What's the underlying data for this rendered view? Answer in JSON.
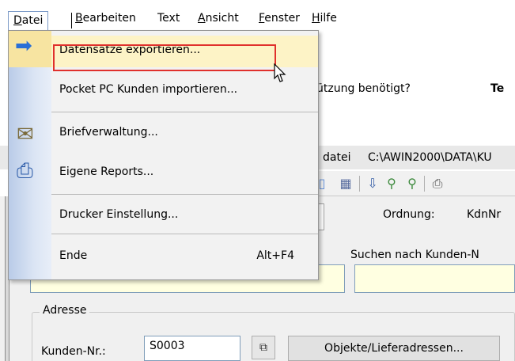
{
  "menubar": {
    "items": [
      {
        "label": "Datei",
        "underline": "D"
      },
      {
        "label": "Bearbeiten",
        "underline": "B"
      },
      {
        "label": "Text",
        "underline": ""
      },
      {
        "label": "Ansicht",
        "underline": "A"
      },
      {
        "label": "Fenster",
        "underline": "F"
      },
      {
        "label": "Hilfe",
        "underline": "H"
      }
    ]
  },
  "background": {
    "question_text": "ützung benötigt?",
    "question_bold": "Te",
    "file_label": "datei",
    "file_path": "C:\\AWIN2000\\DATA\\KU",
    "order_label": "Ordnung:",
    "order_value": "KdnNr",
    "search_label": "Suchen nach Kunden-N",
    "group_label": "Adresse",
    "customer_no_label": "Kunden-Nr.:",
    "customer_no_value": "S0003",
    "objects_button": "Objekte/Lieferadressen..."
  },
  "dropdown": {
    "items": [
      {
        "label": "Datensätze exportieren...",
        "accel": "e",
        "shortcut": "",
        "icon": "arrow-right-icon",
        "highlighted": true
      },
      {
        "label": "Pocket PC Kunden importieren...",
        "accel": "",
        "shortcut": "",
        "icon": "",
        "highlighted": false
      },
      {
        "label": "Briefverwaltung...",
        "accel": "",
        "shortcut": "",
        "icon": "envelope-pen-icon",
        "highlighted": false
      },
      {
        "label": "Eigene Reports...",
        "accel": "",
        "shortcut": "",
        "icon": "printer-icon",
        "highlighted": false
      },
      {
        "label": "Drucker Einstellung...",
        "accel": "D",
        "shortcut": "",
        "icon": "",
        "highlighted": false
      },
      {
        "label": "Ende",
        "accel": "E",
        "shortcut": "Alt+F4",
        "icon": "",
        "highlighted": false
      }
    ]
  },
  "colors": {
    "highlight_bg": "#fdf3c6",
    "highlight_border": "#e0302c",
    "input_yellow": "#ffffe1",
    "menu_bg": "#f2f2f2"
  }
}
